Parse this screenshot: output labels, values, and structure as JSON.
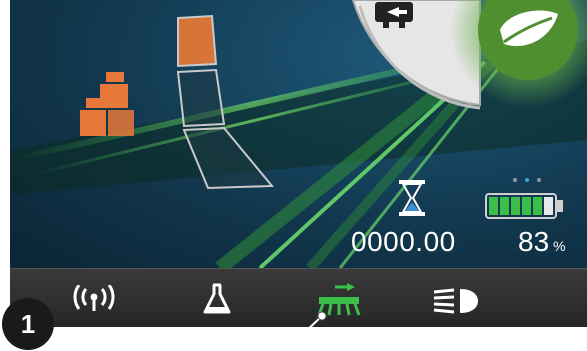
{
  "status": {
    "time_value": "0000.00",
    "battery_value": "83",
    "battery_unit": "%",
    "battery_level": 0.83,
    "page_indicator": {
      "count": 3,
      "active_index": 1
    }
  },
  "callout": {
    "number": "1"
  },
  "colors": {
    "accent_orange": "#e8783a",
    "eco_green": "#6ab04c",
    "battery_green": "#3cbf4a",
    "selected_icon_green": "#3cbf4a",
    "hourglass_blue": "#3a8fd8"
  },
  "icons": {
    "weights": "weights-icon",
    "mode_switch": "mode-switch-icon",
    "eco": "leaf-icon",
    "hourglass": "hourglass-icon",
    "battery": "battery-icon",
    "wireless": "wireless-icon",
    "flask": "flask-icon",
    "sweep": "sweeper-icon",
    "headlight": "headlight-icon"
  }
}
